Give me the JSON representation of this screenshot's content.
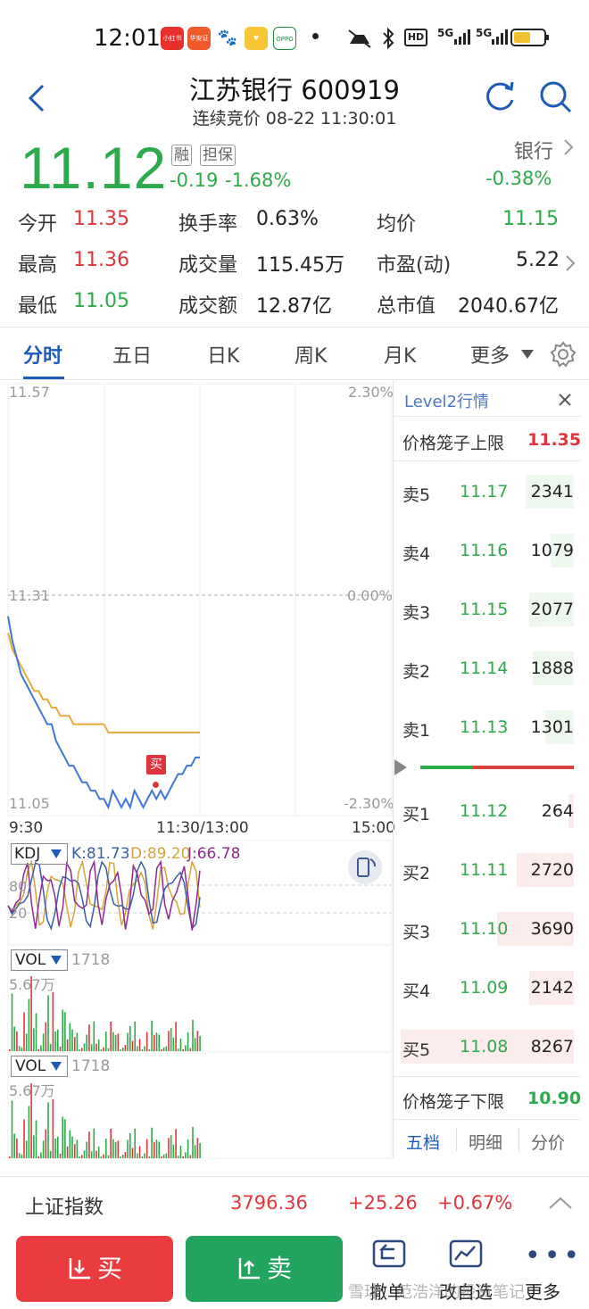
{
  "status_bar": {
    "time": "12:01",
    "app1": "小红书",
    "app2": "华安证券",
    "app4": "OPPO",
    "hd": "HD",
    "net1": "5G",
    "net2": "5G"
  },
  "header": {
    "title": "江苏银行 600919",
    "subtitle": "连续竞价 08-22 11:30:01"
  },
  "quote": {
    "price": "11.12",
    "tag_margin": "融",
    "tag_guarantee": "担保",
    "change": "-0.19",
    "change_pct": "-1.68%",
    "sector_name": "银行",
    "sector_change": "-0.38%",
    "rows": [
      {
        "l1": "今开",
        "v1": "11.35",
        "l2": "换手率",
        "v2": "0.63%",
        "l3": "均价",
        "v3": "11.15"
      },
      {
        "l1": "最高",
        "v1": "11.36",
        "l2": "成交量",
        "v2": "115.45万",
        "l3": "市盈(动)",
        "v3": "5.22"
      },
      {
        "l1": "最低",
        "v1": "11.05",
        "l2": "成交额",
        "v2": "12.87亿",
        "l3": "总市值",
        "v3": "2040.67亿"
      }
    ]
  },
  "tabs": [
    "分时",
    "五日",
    "日K",
    "周K",
    "月K",
    "更多"
  ],
  "chart": {
    "y_top": "11.57",
    "y_mid": "11.31",
    "y_bottom": "11.05",
    "pct_top": "2.30%",
    "pct_mid": "0.00%",
    "pct_bottom": "-2.30%",
    "x_start": "9:30",
    "x_mid": "11:30/13:00",
    "x_end": "15:00",
    "buy_marker": "买",
    "price_series": [
      11.29,
      11.26,
      11.24,
      11.22,
      11.21,
      11.2,
      11.19,
      11.18,
      11.17,
      11.16,
      11.16,
      11.14,
      11.13,
      11.12,
      11.11,
      11.11,
      11.1,
      11.09,
      11.09,
      11.08,
      11.08,
      11.07,
      11.07,
      11.06,
      11.08,
      11.07,
      11.06,
      11.07,
      11.06,
      11.08,
      11.07,
      11.06,
      11.07,
      11.08,
      11.07,
      11.08,
      11.07,
      11.08,
      11.09,
      11.1,
      11.1,
      11.11,
      11.11,
      11.12,
      11.12
    ],
    "avg_series": [
      11.27,
      11.25,
      11.24,
      11.23,
      11.22,
      11.21,
      11.2,
      11.2,
      11.19,
      11.19,
      11.18,
      11.18,
      11.17,
      11.17,
      11.17,
      11.16,
      11.16,
      11.16,
      11.16,
      11.16,
      11.16,
      11.16,
      11.16,
      11.15,
      11.15,
      11.15,
      11.15,
      11.15,
      11.15,
      11.15,
      11.15,
      11.15,
      11.15,
      11.15,
      11.15,
      11.15,
      11.15,
      11.15,
      11.15,
      11.15,
      11.15,
      11.15,
      11.15,
      11.15,
      11.15
    ],
    "price_color": "#3d78d8",
    "avg_color": "#e8a93a"
  },
  "kdj": {
    "label": "KDJ",
    "k": "K:81.73",
    "d": "D:89.20",
    "j": "J:66.78",
    "level_high": "80",
    "level_low": "20"
  },
  "vol1": {
    "label": "VOL",
    "value": "1718",
    "max": "5.67万"
  },
  "vol2": {
    "label": "VOL",
    "value": "1718",
    "max": "5.67万"
  },
  "orderbook": {
    "title": "Level2行情",
    "upper_label": "价格笼子上限",
    "upper_value": "11.35",
    "asks": [
      {
        "label": "卖5",
        "price": "11.17",
        "vol": "2341"
      },
      {
        "label": "卖4",
        "price": "11.16",
        "vol": "1079"
      },
      {
        "label": "卖3",
        "price": "11.15",
        "vol": "2077"
      },
      {
        "label": "卖2",
        "price": "11.14",
        "vol": "1888"
      },
      {
        "label": "卖1",
        "price": "11.13",
        "vol": "1301"
      }
    ],
    "bids": [
      {
        "label": "买1",
        "price": "11.12",
        "vol": "264"
      },
      {
        "label": "买2",
        "price": "11.11",
        "vol": "2720"
      },
      {
        "label": "买3",
        "price": "11.10",
        "vol": "3690"
      },
      {
        "label": "买4",
        "price": "11.09",
        "vol": "2142"
      },
      {
        "label": "买5",
        "price": "11.08",
        "vol": "8267"
      }
    ],
    "lower_label": "价格笼子下限",
    "lower_value": "10.90",
    "bottom_tabs": [
      "五档",
      "明细",
      "分价"
    ]
  },
  "index_bar": {
    "name": "上证指数",
    "value": "3796.36",
    "change": "+25.26",
    "change_pct": "+0.67%"
  },
  "bottom_bar": {
    "buy": "买",
    "sell": "卖",
    "action1": "撤单",
    "action2": "改自选",
    "action3": "更多",
    "watermark": "雪球：范浩洋的投资笔记"
  }
}
